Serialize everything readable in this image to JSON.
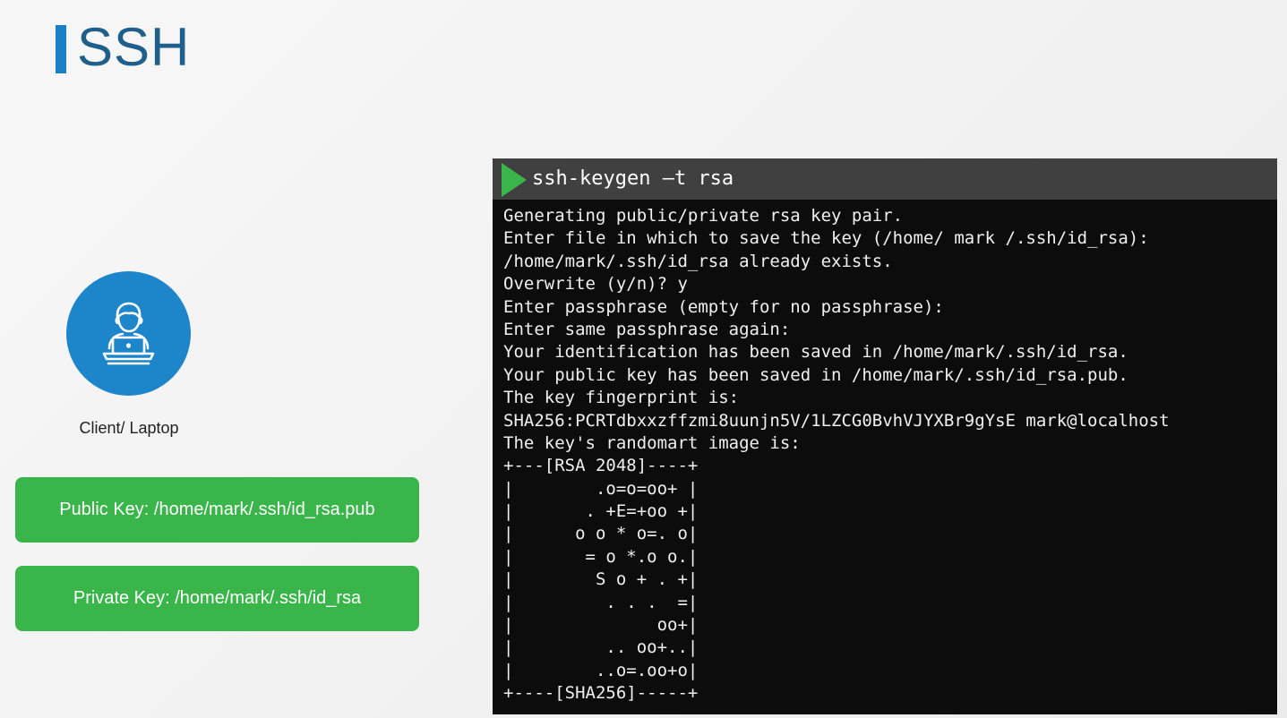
{
  "slide": {
    "title": "SSH",
    "accent_color": "#1a7fc4",
    "title_color": "#1f5f8b"
  },
  "client": {
    "icon": "person-laptop-icon",
    "label": "Client/ Laptop"
  },
  "keys": {
    "public_label": "Public Key: /home/mark/.ssh/id_rsa.pub",
    "private_label": "Private Key: /home/mark/.ssh/id_rsa",
    "box_color": "#3ab54a"
  },
  "terminal": {
    "prompt_icon": "play-icon",
    "command": "ssh-keygen –t rsa",
    "lines": [
      "Generating public/private rsa key pair.",
      "Enter file in which to save the key (/home/ mark /.ssh/id_rsa):",
      "/home/mark/.ssh/id_rsa already exists.",
      "Overwrite (y/n)? y",
      "Enter passphrase (empty for no passphrase):",
      "Enter same passphrase again:",
      "Your identification has been saved in /home/mark/.ssh/id_rsa.",
      "Your public key has been saved in /home/mark/.ssh/id_rsa.pub.",
      "The key fingerprint is:",
      "SHA256:PCRTdbxxzffzmi8uunjn5V/1LZCG0BvhVJYXBr9gYsE mark@localhost",
      "The key's randomart image is:",
      "+---[RSA 2048]----+",
      "|        .o=o=oo+ |",
      "|       . +E=+oo +|",
      "|      o o * o=. o|",
      "|       = o *.o o.|",
      "|        S o + . +|",
      "|         . . .  =|",
      "|              oo+|",
      "|         .. oo+..|",
      "|        ..o=.oo+o|",
      "+----[SHA256]-----+"
    ]
  }
}
